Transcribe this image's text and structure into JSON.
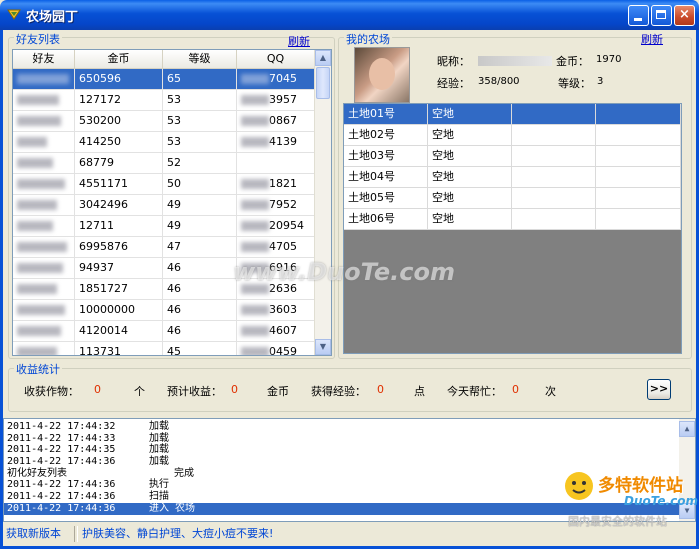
{
  "window": {
    "title": "农场园丁",
    "minimize": "",
    "maximize": "",
    "close": "×"
  },
  "friends_panel": {
    "title": "好友列表",
    "refresh": "刷新",
    "columns": [
      "好友",
      "金币",
      "等级",
      "QQ"
    ],
    "rows": [
      {
        "coins": "650596",
        "level": "65",
        "qq": "7045",
        "selected": true
      },
      {
        "coins": "127172",
        "level": "53",
        "qq": "3957"
      },
      {
        "coins": "530200",
        "level": "53",
        "qq": "0867"
      },
      {
        "coins": "414250",
        "level": "53",
        "qq": "4139"
      },
      {
        "coins": "68779",
        "level": "52",
        "qq": ""
      },
      {
        "coins": "4551171",
        "level": "50",
        "qq": "1821"
      },
      {
        "coins": "3042496",
        "level": "49",
        "qq": "7952"
      },
      {
        "coins": "12711",
        "level": "49",
        "qq": "20954"
      },
      {
        "coins": "6995876",
        "level": "47",
        "qq": "4705"
      },
      {
        "coins": "94937",
        "level": "46",
        "qq": "6916"
      },
      {
        "coins": "1851727",
        "level": "46",
        "qq": "2636"
      },
      {
        "coins": "10000000",
        "level": "46",
        "qq": "3603"
      },
      {
        "coins": "4120014",
        "level": "46",
        "qq": "4607"
      },
      {
        "coins": "113731",
        "level": "45",
        "qq": "0459"
      }
    ]
  },
  "my_farm": {
    "title": "我的农场",
    "refresh": "刷新",
    "nickname_label": "昵称：",
    "coins_label": "金币：",
    "coins_value": "1970",
    "exp_label": "经验：",
    "exp_value": "358/800",
    "level_label": "等级：",
    "level_value": "3",
    "plots": [
      {
        "name": "土地01号",
        "status": "空地",
        "selected": true
      },
      {
        "name": "土地02号",
        "status": "空地"
      },
      {
        "name": "土地03号",
        "status": "空地"
      },
      {
        "name": "土地04号",
        "status": "空地"
      },
      {
        "name": "土地05号",
        "status": "空地"
      },
      {
        "name": "土地06号",
        "status": "空地"
      }
    ]
  },
  "stats": {
    "title": "收益统计",
    "harvest_label": "收获作物：",
    "harvest_value": "0",
    "harvest_unit": "个",
    "income_label": "预计收益：",
    "income_value": "0",
    "income_unit": "金币",
    "exp_label": "获得经验：",
    "exp_value": "0",
    "exp_unit": "点",
    "help_label": "今天帮忙：",
    "help_value": "0",
    "help_unit": "次",
    "go_button": ">>"
  },
  "log": [
    {
      "time": "2011-4-22 17:44:32",
      "msg": "加载"
    },
    {
      "time": "2011-4-22 17:44:33",
      "msg": "加载"
    },
    {
      "time": "2011-4-22 17:44:35",
      "msg": "加载"
    },
    {
      "time": "2011-4-22 17:44:36",
      "msg": "加载"
    },
    {
      "time": "初化好友列表",
      "msg": "完成"
    },
    {
      "time": "2011-4-22 17:44:36",
      "msg": "执行"
    },
    {
      "time": "2011-4-22 17:44:36",
      "msg": "扫描"
    },
    {
      "time": "2011-4-22 17:44:36",
      "msg": "进入                农场",
      "selected": true
    }
  ],
  "statusbar": {
    "left": "获取新版本",
    "right": "护肤美容、静白护理、大痘小痘不要来!"
  },
  "watermark": {
    "center": "www.DuoTe.com",
    "logo": "多特软件站",
    "logo_url": "DuoTe.com",
    "logo_sub": "国内最安全的软件站"
  }
}
